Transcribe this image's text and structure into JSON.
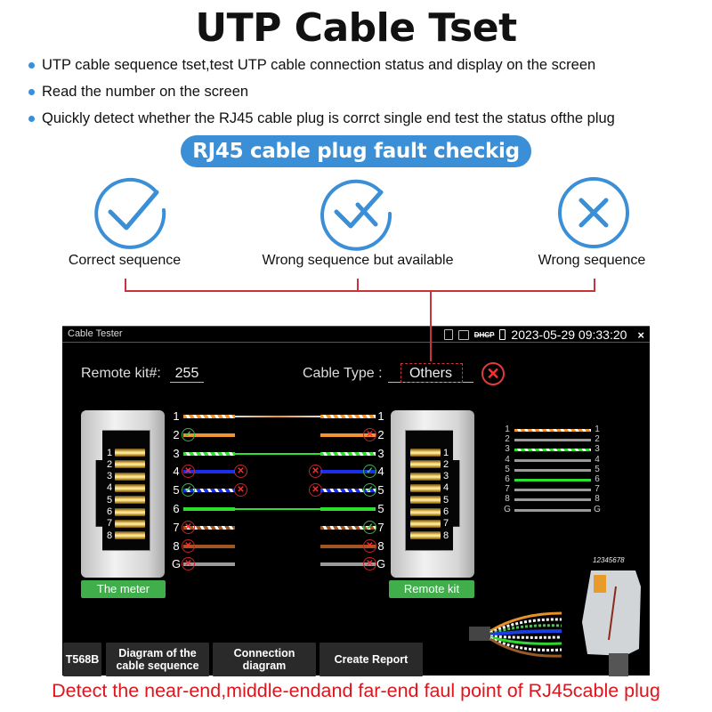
{
  "header": {
    "title": "UTP Cable Tset",
    "bullets": [
      "UTP cable sequence tset,test UTP cable connection status and display on the screen",
      "Read the number on the screen",
      "Quickly detect whether the RJ45 cable plug is corrct single end test the status ofthe plug"
    ]
  },
  "fault_section": {
    "pill_label": "RJ45 cable plug fault checkig",
    "statuses": [
      {
        "icon": "check-circle-icon",
        "label": "Correct sequence"
      },
      {
        "icon": "check-cross-circle-icon",
        "label": "Wrong sequence but available"
      },
      {
        "icon": "cross-circle-icon",
        "label": "Wrong sequence"
      }
    ],
    "colors": {
      "accent": "#3a8fd6",
      "connector": "#c9343b"
    }
  },
  "device": {
    "app_title": "Cable Tester",
    "status_icons": [
      "sd-card-icon",
      "screen-off-icon",
      "dhcp-off-icon",
      "battery-icon"
    ],
    "dhcp_label": "DHCP",
    "datetime": "2023-05-29 09:33:20",
    "close_label": "×",
    "remote_kit_label": "Remote kit#:",
    "remote_kit_value": "255",
    "cable_type_label": "Cable Type :",
    "cable_type_value": "Others",
    "cable_status": "error",
    "meter_label": "The meter",
    "remote_label": "Remote kit",
    "jack_pins": [
      "1",
      "2",
      "3",
      "4",
      "5",
      "6",
      "7",
      "8"
    ],
    "wires": [
      {
        "left_num": "1",
        "right_num": "1",
        "color": "orange-white",
        "left_mark": "none",
        "left_mid_mark": "none",
        "right_mid_mark": "none",
        "right_mark": "none",
        "connected": true
      },
      {
        "left_num": "2",
        "right_num": "2",
        "color": "orange",
        "left_mark": "ok",
        "left_mid_mark": "none",
        "right_mid_mark": "none",
        "right_mark": "bad",
        "connected": false
      },
      {
        "left_num": "3",
        "right_num": "3",
        "color": "green-white",
        "left_mark": "none",
        "left_mid_mark": "none",
        "right_mid_mark": "none",
        "right_mark": "none",
        "connected": true
      },
      {
        "left_num": "4",
        "right_num": "4",
        "color": "blue",
        "left_mark": "bad",
        "left_mid_mark": "bad",
        "right_mid_mark": "bad",
        "right_mark": "ok",
        "connected": false
      },
      {
        "left_num": "5",
        "right_num": "5",
        "color": "blue-white",
        "left_mark": "ok",
        "left_mid_mark": "bad",
        "right_mid_mark": "bad",
        "right_mark": "ok",
        "connected": false
      },
      {
        "left_num": "6",
        "right_num": "5",
        "color": "green",
        "left_mark": "none",
        "left_mid_mark": "none",
        "right_mid_mark": "none",
        "right_mark": "none",
        "connected": true
      },
      {
        "left_num": "7",
        "right_num": "7",
        "color": "brown-white",
        "left_mark": "bad",
        "left_mid_mark": "none",
        "right_mid_mark": "none",
        "right_mark": "ok",
        "connected": false
      },
      {
        "left_num": "8",
        "right_num": "8",
        "color": "brown",
        "left_mark": "bad",
        "left_mid_mark": "none",
        "right_mid_mark": "none",
        "right_mark": "bad",
        "connected": false
      },
      {
        "left_num": "G",
        "right_num": "G",
        "color": "gray",
        "left_mark": "bad",
        "left_mid_mark": "none",
        "right_mid_mark": "none",
        "right_mark": "bad",
        "connected": false
      }
    ],
    "sequence_map": [
      {
        "left": "1",
        "right": "1",
        "color": "orange-white"
      },
      {
        "left": "2",
        "right": "2",
        "color": "gray"
      },
      {
        "left": "3",
        "right": "3",
        "color": "green-white"
      },
      {
        "left": "4",
        "right": "4",
        "color": "gray"
      },
      {
        "left": "5",
        "right": "5",
        "color": "gray"
      },
      {
        "left": "6",
        "right": "6",
        "color": "green"
      },
      {
        "left": "7",
        "right": "7",
        "color": "gray"
      },
      {
        "left": "8",
        "right": "8",
        "color": "gray"
      },
      {
        "left": "G",
        "right": "G",
        "color": "gray"
      }
    ],
    "plug_pin_label": "12345678",
    "bottom_buttons": [
      {
        "label": "T568B"
      },
      {
        "label": "Diagram of the cable sequence"
      },
      {
        "label": "Connection diagram"
      },
      {
        "label": "Create Report"
      }
    ]
  },
  "footer": "Detect the near-end,middle-endand far-end faul point of RJ45cable plug"
}
